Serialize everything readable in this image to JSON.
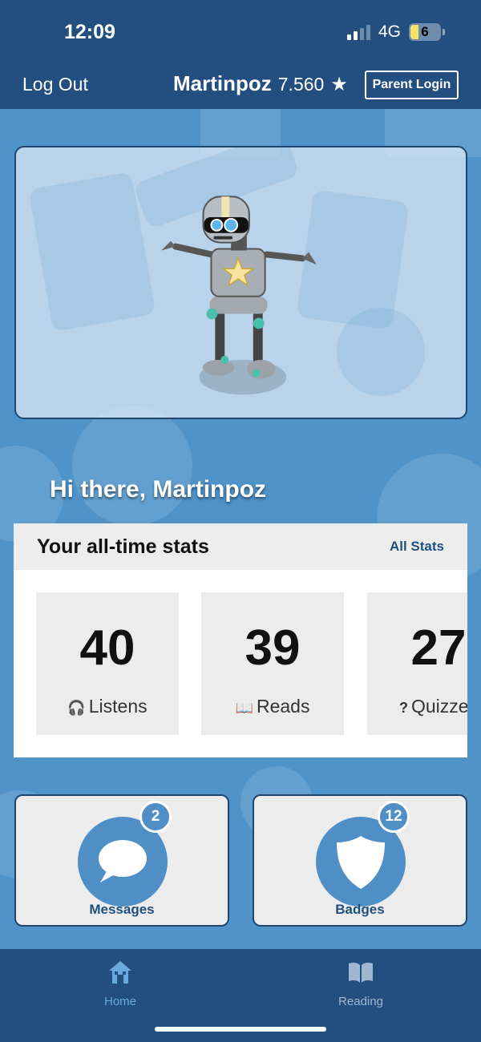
{
  "status_bar": {
    "time": "12:09",
    "network": "4G",
    "battery": "6"
  },
  "header": {
    "logout_label": "Log Out",
    "username": "Martinpoz",
    "points": "7.560",
    "parent_login_label": "Parent Login"
  },
  "greeting": "Hi there, Martinpoz",
  "stats": {
    "title": "Your all-time stats",
    "all_stats_label": "All Stats",
    "tiles": [
      {
        "value": "40",
        "label": "Listens",
        "icon": "headphones-icon"
      },
      {
        "value": "39",
        "label": "Reads",
        "icon": "book-icon"
      },
      {
        "value": "27",
        "label": "Quizzes",
        "icon": "question-icon"
      }
    ]
  },
  "cards": {
    "messages": {
      "label": "Messages",
      "count": "2"
    },
    "badges": {
      "label": "Badges",
      "count": "12"
    }
  },
  "tabs": [
    {
      "label": "Home",
      "icon": "home-icon",
      "active": true
    },
    {
      "label": "Reading",
      "icon": "open-book-icon",
      "active": false
    }
  ],
  "colors": {
    "header_bg": "#234f80",
    "main_bg": "#4f93c9",
    "accent_blue": "#1e4f7f",
    "tile_bg": "#ececec"
  }
}
